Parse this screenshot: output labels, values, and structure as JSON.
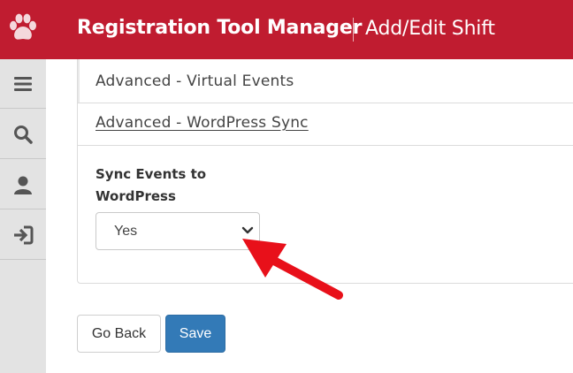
{
  "header": {
    "app_title": "Registration Tool Manager",
    "page_subtitle": "Add/Edit Shift",
    "background_color": "#c01c30",
    "logo_icon": "paw-icon"
  },
  "sidebar": {
    "background_color": "#e3e3e3",
    "items": [
      {
        "icon": "menu-icon"
      },
      {
        "icon": "search-icon"
      },
      {
        "icon": "user-icon"
      },
      {
        "icon": "sign-in-icon"
      }
    ]
  },
  "sections": [
    {
      "title": "Advanced - Virtual Events"
    },
    {
      "title": "Advanced - WordPress Sync"
    }
  ],
  "sync_field": {
    "label": "Sync Events to WordPress",
    "value": "Yes"
  },
  "annotation": {
    "icon": "red-arrow-icon",
    "color": "#e8101a"
  },
  "buttons": {
    "back_label": "Go Back",
    "save_label": "Save",
    "save_color": "#337ab7"
  }
}
